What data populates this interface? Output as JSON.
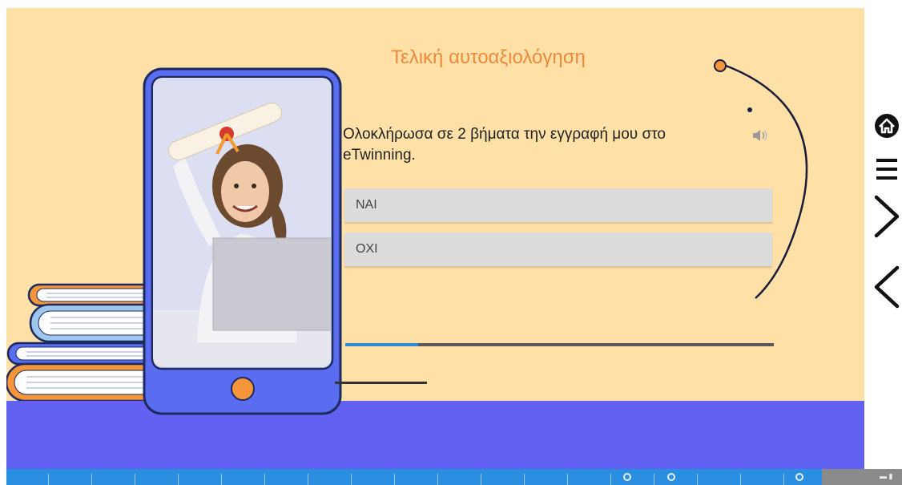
{
  "slide": {
    "title": "Τελική αυτοαξιολόγηση",
    "question": "Ολοκλήρωσα σε 2 βήματα την εγγραφή μου στο eTwinning.",
    "answers": [
      "ΝΑΙ",
      "ΟΧΙ"
    ],
    "progress_fraction": 0.17
  },
  "icons": {
    "audio": "speaker-icon",
    "home": "home-icon",
    "menu": "menu-icon",
    "next": "chevron-right-icon",
    "prev": "chevron-left-icon"
  },
  "colors": {
    "background": "#ffe1a8",
    "band": "#6161f2",
    "title": "#ee8a3c",
    "accent_orange": "#f7953a",
    "phone_frame": "#5a6cf0",
    "timeline": "#2a8ee0",
    "progress": "#2e8ad8"
  },
  "timeline": {
    "end_label": "▬ ▮"
  }
}
